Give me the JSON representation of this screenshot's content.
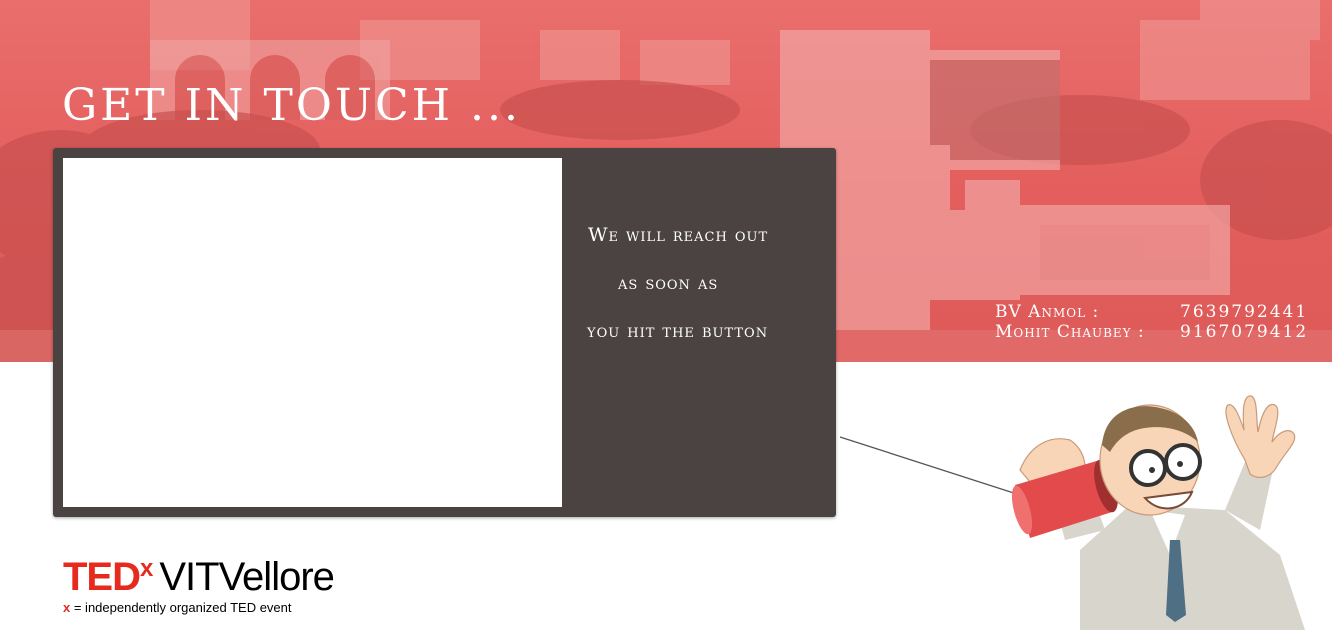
{
  "banner": {
    "title": "GET IN TOUCH ..."
  },
  "card": {
    "message_lines": [
      "We will reach out",
      "as soon as",
      "you hit the button"
    ]
  },
  "contacts": [
    {
      "name": "BV Anmol :",
      "phone": "7639792441"
    },
    {
      "name": "Mohit Chaubey :",
      "phone": "9167079412"
    }
  ],
  "logo": {
    "ted": "TED",
    "x": "x",
    "event": "VITVellore",
    "tagline_x": "x",
    "tagline": " = independently organized TED event"
  },
  "colors": {
    "banner": "#e35e5d",
    "card": "#4a4341",
    "ted_red": "#e62b1e"
  },
  "icons": {
    "illustration": "man-with-tin-can-phone-illustration"
  }
}
